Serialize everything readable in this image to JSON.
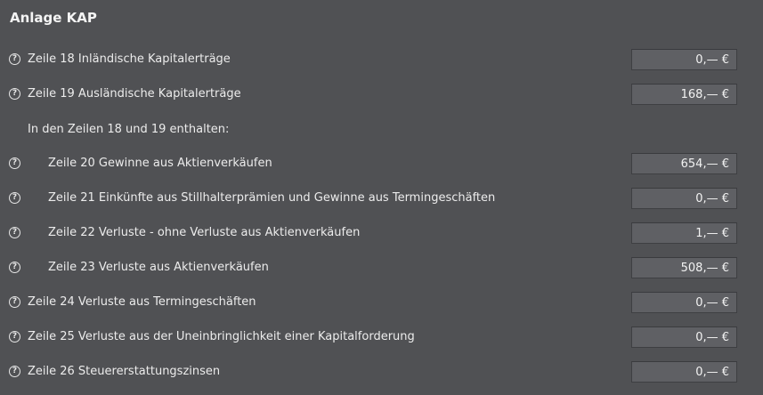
{
  "title": "Anlage KAP",
  "help_glyph": "?",
  "subheading": "In den Zeilen 18 und 19 enthalten:",
  "rows": [
    {
      "label": "Zeile 18 Inländische Kapitalerträge",
      "value": "0,— €"
    },
    {
      "label": "Zeile 19 Ausländische Kapitalerträge",
      "value": "168,— €"
    },
    {
      "label": "Zeile 20 Gewinne aus Aktienverkäufen",
      "value": "654,— €"
    },
    {
      "label": "Zeile 21 Einkünfte aus Stillhalterprämien und Gewinne aus Termingeschäften",
      "value": "0,— €"
    },
    {
      "label": "Zeile 22 Verluste - ohne Verluste aus Aktienverkäufen",
      "value": "1,— €"
    },
    {
      "label": "Zeile 23 Verluste aus Aktienverkäufen",
      "value": "508,— €"
    },
    {
      "label": "Zeile 24 Verluste aus Termingeschäften",
      "value": "0,— €"
    },
    {
      "label": "Zeile 25 Verluste aus der Uneinbringlichkeit einer Kapitalforderung",
      "value": "0,— €"
    },
    {
      "label": "Zeile 26 Steuererstattungszinsen",
      "value": "0,— €"
    }
  ],
  "icons": {
    "help": "question-circle-icon"
  }
}
